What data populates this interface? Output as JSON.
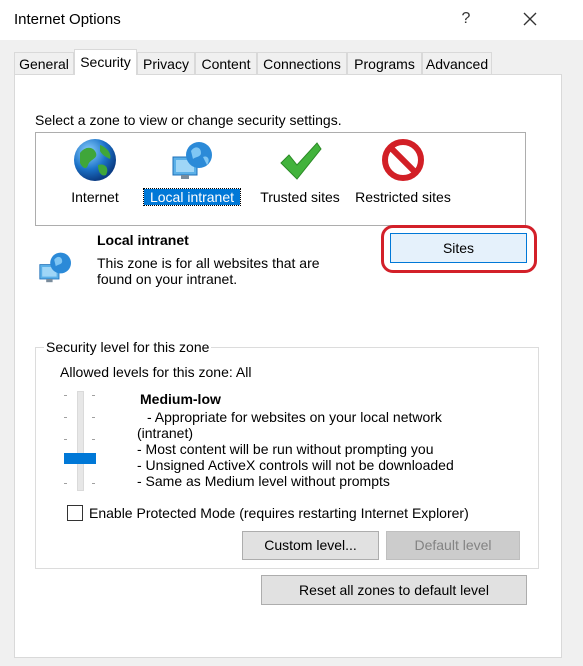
{
  "window": {
    "title": "Internet Options",
    "help_glyph": "?",
    "close_glyph": "×"
  },
  "tabs": [
    {
      "label": "General"
    },
    {
      "label": "Security",
      "active": true
    },
    {
      "label": "Privacy"
    },
    {
      "label": "Content"
    },
    {
      "label": "Connections"
    },
    {
      "label": "Programs"
    },
    {
      "label": "Advanced"
    }
  ],
  "security": {
    "zone_prompt": "Select a zone to view or change security settings.",
    "zones": [
      {
        "label": "Internet",
        "icon": "globe-icon"
      },
      {
        "label": "Local intranet",
        "icon": "network-globe-icon",
        "selected": true
      },
      {
        "label": "Trusted sites",
        "icon": "checkmark-icon"
      },
      {
        "label": "Restricted sites",
        "icon": "prohibited-icon"
      }
    ],
    "selected_zone": {
      "name": "Local intranet",
      "description": "This zone is for all websites that are found on your intranet.",
      "sites_button": "Sites"
    },
    "level_group": {
      "legend": "Security level for this zone",
      "allowed": "Allowed levels for this zone: All",
      "level_name": "Medium-low",
      "level_lines": [
        "- Appropriate for websites on your local network",
        "(intranet)",
        "- Most content will be run without prompting you",
        "- Unsigned ActiveX controls will not be downloaded",
        "- Same as Medium level without prompts"
      ],
      "slider_level": "Medium-low"
    },
    "protected_mode_label": "Enable Protected Mode (requires restarting Internet Explorer)",
    "protected_mode_checked": false,
    "custom_level_button": "Custom level...",
    "default_level_button": "Default level",
    "reset_button": "Reset all zones to default level"
  },
  "colors": {
    "highlight_ring": "#d32029",
    "selection": "#0078d7"
  }
}
